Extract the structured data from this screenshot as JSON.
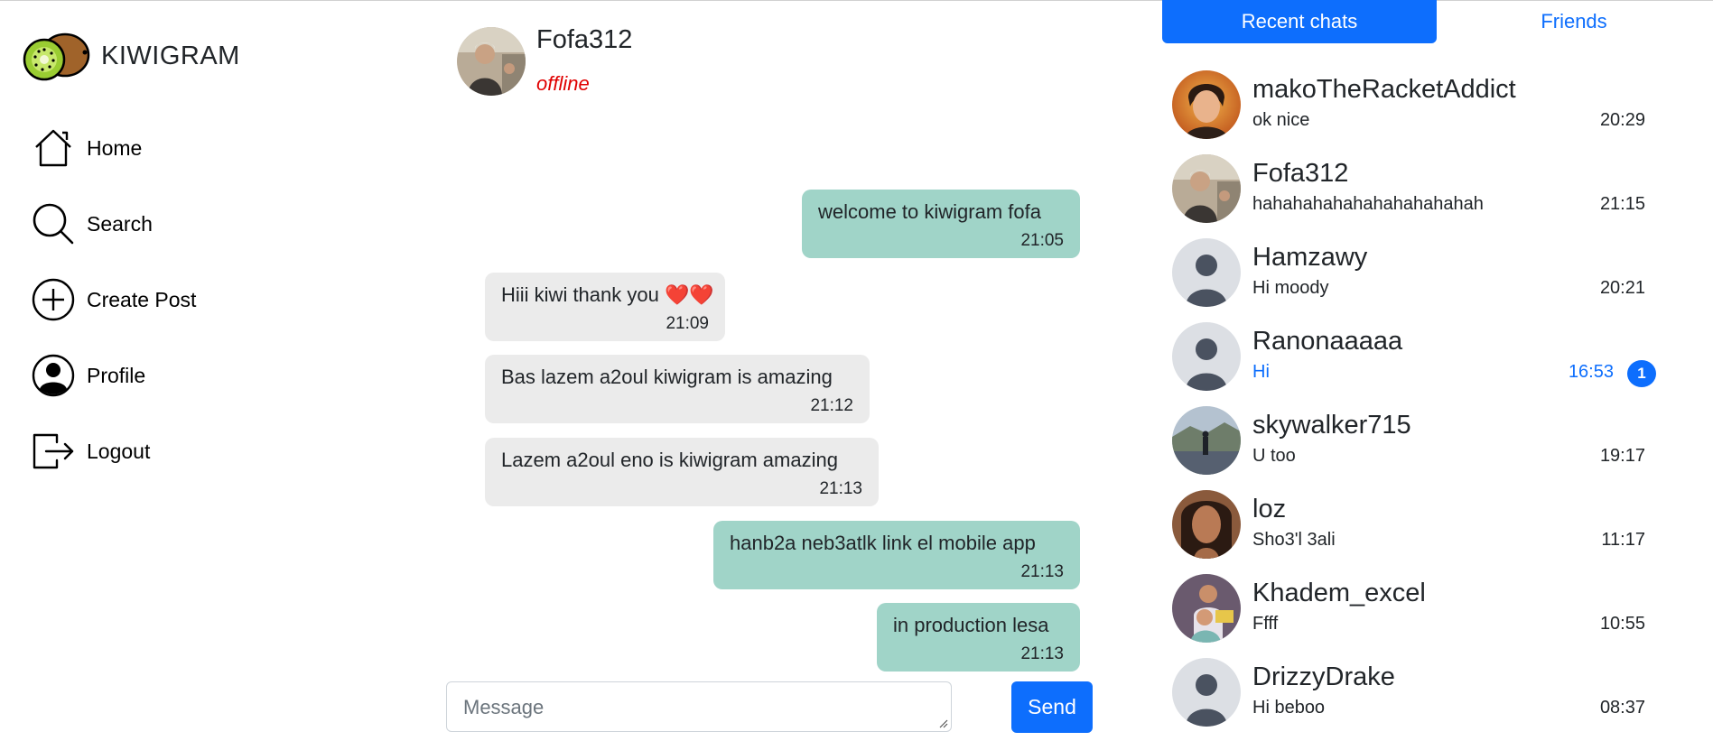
{
  "app": {
    "name": "KIWIGRAM"
  },
  "sidebar": {
    "items": [
      {
        "label": "Home",
        "icon": "home-icon"
      },
      {
        "label": "Search",
        "icon": "search-icon"
      },
      {
        "label": "Create Post",
        "icon": "plus-circle-icon"
      },
      {
        "label": "Profile",
        "icon": "user-circle-icon"
      },
      {
        "label": "Logout",
        "icon": "logout-icon"
      }
    ]
  },
  "chat": {
    "name": "Fofa312",
    "status": "offline",
    "messages": [
      {
        "text": "welcome to kiwigram fofa",
        "time": "21:05",
        "direction": "out"
      },
      {
        "text": "Hiii kiwi thank you ❤️❤️",
        "time": "21:09",
        "direction": "in"
      },
      {
        "text": "Bas lazem a2oul kiwigram is amazing",
        "time": "21:12",
        "direction": "in"
      },
      {
        "text": "Lazem a2oul eno is kiwigram amazing",
        "time": "21:13",
        "direction": "in"
      },
      {
        "text": "hanb2a neb3atlk link el mobile app",
        "time": "21:13",
        "direction": "out"
      },
      {
        "text": "in production lesa",
        "time": "21:13",
        "direction": "out"
      }
    ]
  },
  "compose": {
    "placeholder": "Message",
    "value": "",
    "send_label": "Send"
  },
  "tabs": [
    {
      "label": "Recent chats",
      "active": true
    },
    {
      "label": "Friends",
      "active": false
    }
  ],
  "recent_chats": [
    {
      "name": "makoTheRacketAddict",
      "preview": "ok nice",
      "time": "20:29",
      "unread": 0,
      "avatar": "cartoon-photo"
    },
    {
      "name": "Fofa312",
      "preview": "hahahahahahahahahahahah",
      "time": "21:15",
      "unread": 0,
      "avatar": "person-photo"
    },
    {
      "name": "Hamzawy",
      "preview": "Hi moody",
      "time": "20:21",
      "unread": 0,
      "avatar": "default"
    },
    {
      "name": "Ranonaaaaa",
      "preview": "Hi",
      "time": "16:53",
      "unread": 1,
      "avatar": "default"
    },
    {
      "name": "skywalker715",
      "preview": "U too",
      "time": "19:17",
      "unread": 0,
      "avatar": "landscape-photo"
    },
    {
      "name": "loz",
      "preview": "Sho3'l 3ali",
      "time": "11:17",
      "unread": 0,
      "avatar": "portrait-photo"
    },
    {
      "name": "Khadem_excel",
      "preview": "Ffff",
      "time": "10:55",
      "unread": 0,
      "avatar": "group-photo"
    },
    {
      "name": "DrizzyDrake",
      "preview": "Hi beboo",
      "time": "08:37",
      "unread": 0,
      "avatar": "default"
    }
  ],
  "colors": {
    "accent": "#0d6efd",
    "outgoing_bubble": "#a0d4c8",
    "incoming_bubble": "#ebebeb",
    "offline": "#e00000",
    "kiwi_green": "#9acd32",
    "kiwi_brown": "#a0632a"
  }
}
